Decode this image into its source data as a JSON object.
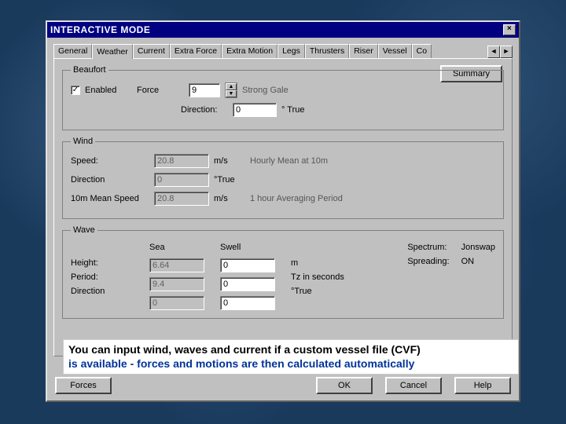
{
  "window": {
    "title": "INTERACTIVE MODE"
  },
  "tabs": {
    "items": [
      "General",
      "Weather",
      "Current",
      "Extra Force",
      "Extra Motion",
      "Legs",
      "Thrusters",
      "Riser",
      "Vessel",
      "Co"
    ],
    "active": 1
  },
  "summary_label": "Summary",
  "beaufort": {
    "legend": "Beaufort",
    "enabled_label": "Enabled",
    "force_label": "Force",
    "force_value": "9",
    "force_desc": "Strong Gale",
    "direction_label": "Direction:",
    "direction_value": "0",
    "direction_unit": "° True"
  },
  "wind": {
    "legend": "Wind",
    "speed_label": "Speed:",
    "speed_value": "20.8",
    "speed_unit": "m/s",
    "speed_note": "Hourly Mean at 10m",
    "direction_label": "Direction",
    "direction_value": "0",
    "direction_unit": "°True",
    "mean_label": "10m Mean Speed",
    "mean_value": "20.8",
    "mean_unit": "m/s",
    "mean_note": "1 hour Averaging Period"
  },
  "wave": {
    "legend": "Wave",
    "col_sea": "Sea",
    "col_swell": "Swell",
    "height_label": "Height:",
    "period_label": "Period:",
    "direction_label": "Direction",
    "sea_height": "6.64",
    "sea_period": "9.4",
    "sea_direction": "0",
    "swell_height": "0",
    "swell_period": "0",
    "swell_direction": "0",
    "height_unit": "m",
    "period_unit": "Tz in seconds",
    "direction_unit": "°True",
    "spectrum_label": "Spectrum:",
    "spectrum_value": "Jonswap",
    "spreading_label": "Spreading:",
    "spreading_value": "ON"
  },
  "buttons": {
    "forces": "Forces",
    "ok": "OK",
    "cancel": "Cancel",
    "help": "Help"
  },
  "overlay": {
    "line1": "You can input wind, waves and current if a custom vessel file (CVF)",
    "line2": "is available - forces and motions are then calculated automatically"
  }
}
